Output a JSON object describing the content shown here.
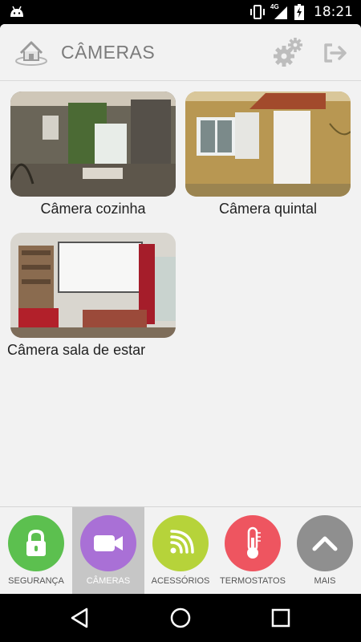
{
  "status_bar": {
    "time": "18:21",
    "network": "4G"
  },
  "header": {
    "title": "CÂMERAS"
  },
  "cameras": [
    {
      "name": "Câmera cozinha"
    },
    {
      "name": "Câmera quintal"
    },
    {
      "name": "Câmera sala de estar"
    }
  ],
  "tabs": [
    {
      "label": "SEGURANÇA",
      "color": "#5cc04f",
      "icon": "lock-icon"
    },
    {
      "label": "CÂMERAS",
      "color": "#a970d6",
      "icon": "video-camera-icon",
      "active": true
    },
    {
      "label": "ACESSÓRIOS",
      "color": "#b6d33a",
      "icon": "wireless-icon"
    },
    {
      "label": "TERMOSTATOS",
      "color": "#ee5560",
      "icon": "thermometer-icon"
    },
    {
      "label": "MAIS",
      "color": "#8f8f8f",
      "icon": "chevron-up-icon"
    }
  ]
}
